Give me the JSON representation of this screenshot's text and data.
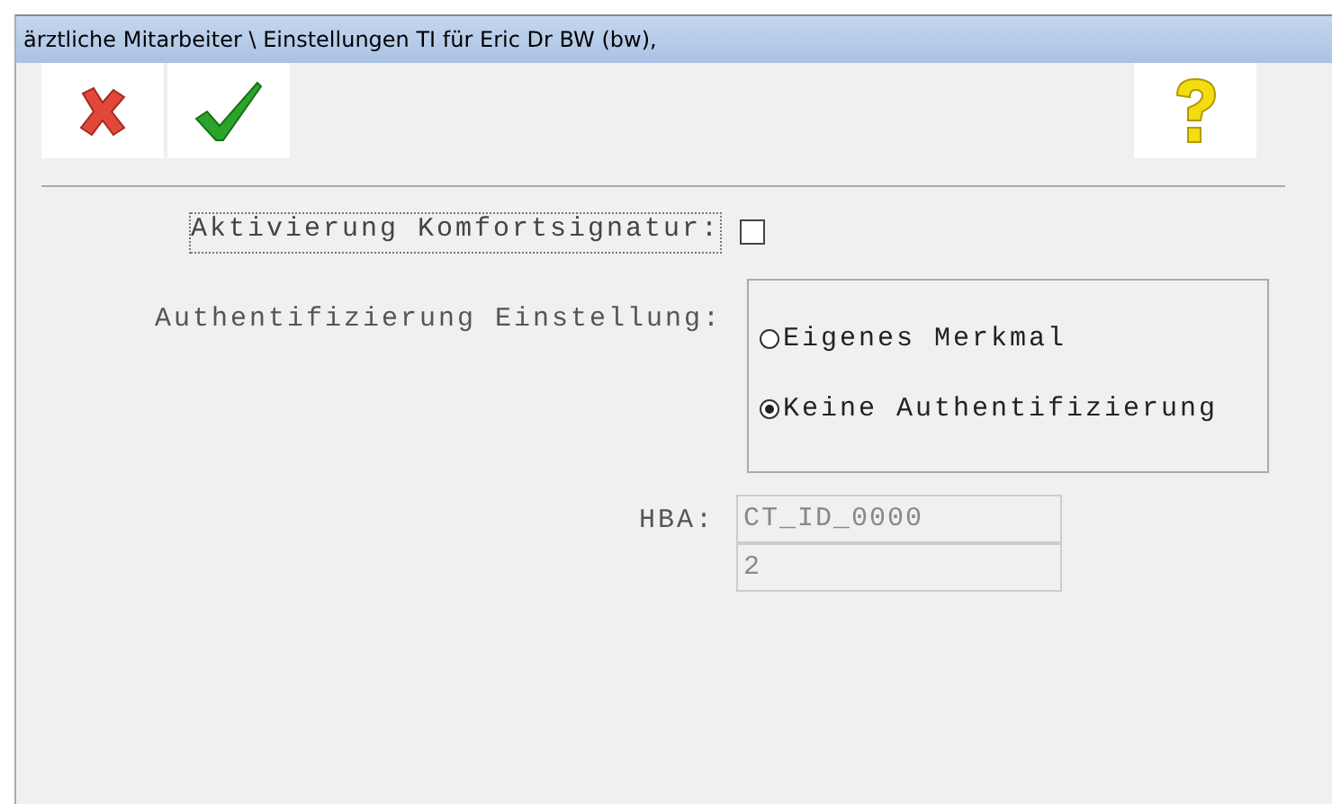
{
  "window": {
    "title": "ärztliche Mitarbeiter \\ Einstellungen TI für Eric Dr BW (bw),"
  },
  "toolbar": [
    {
      "kind": "cancel"
    },
    {
      "kind": "ok"
    },
    {
      "kind": "help"
    }
  ],
  "komfort": {
    "label": "Aktivierung Komfortsignatur:",
    "checked": false
  },
  "auth": {
    "label": "Authentifizierung Einstellung:",
    "options": [
      {
        "label": "Eigenes Merkmal",
        "selected": false
      },
      {
        "label": "Keine Authentifizierung",
        "selected": true
      }
    ]
  },
  "hba": {
    "label": "HBA:",
    "fields": [
      {
        "value": "CT_ID_0000",
        "disabled": true
      },
      {
        "value": "2",
        "disabled": true
      }
    ]
  }
}
